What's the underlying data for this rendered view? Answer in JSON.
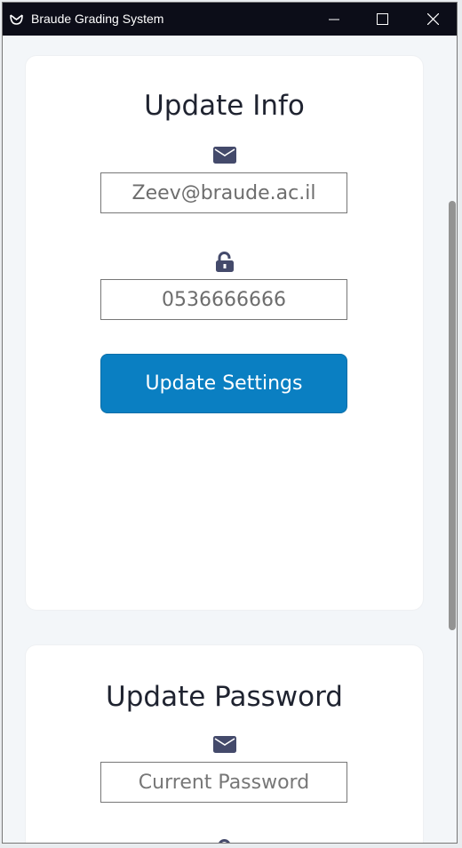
{
  "window": {
    "title": "Braude Grading System",
    "minimize_icon": "minimize-icon",
    "maximize_icon": "maximize-icon",
    "close_icon": "close-icon"
  },
  "update_info": {
    "title": "Update Info",
    "email_icon": "envelope-icon",
    "email_value": "Zeev@braude.ac.il",
    "phone_icon": "unlock-icon",
    "phone_value": "0536666666",
    "button_label": "Update Settings",
    "button_color": "#0a7fc2"
  },
  "update_password": {
    "title": "Update Password",
    "icon": "envelope-icon",
    "current_password_placeholder": "Current Password"
  }
}
